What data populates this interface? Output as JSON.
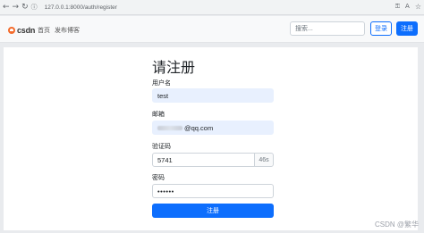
{
  "browser": {
    "url": "127.0.0.1:8000/auth/register"
  },
  "navbar": {
    "brand": "csdn",
    "links": [
      "首页",
      "发布博客"
    ],
    "search_placeholder": "搜索...",
    "login_label": "登录",
    "register_label": "注册"
  },
  "form": {
    "title": "请注册",
    "username_label": "用户名",
    "username_value": "test",
    "email_label": "邮箱",
    "email_value": "@qq.com",
    "code_label": "验证码",
    "code_value": "5741",
    "countdown": "46s",
    "password_label": "密码",
    "password_value": "••••••",
    "submit_label": "注册"
  },
  "watermark": "CSDN @繁华"
}
